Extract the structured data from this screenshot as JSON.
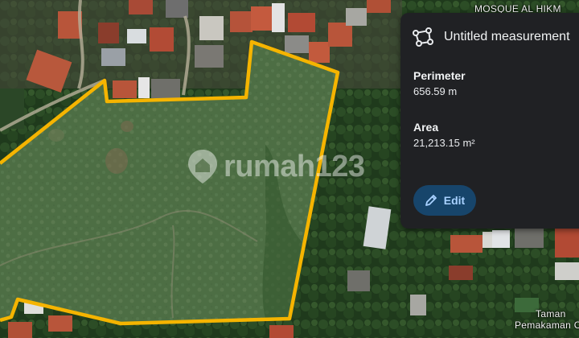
{
  "map": {
    "labels": {
      "mosque": "MOSQUE AL HIKM",
      "taman_line1": "Taman",
      "taman_line2": "Pemakaman Cu"
    },
    "watermark": "rumah123",
    "outline_color": "#f5b400"
  },
  "measurement_panel": {
    "title": "Untitled measurement",
    "icon": "polygon-measure-icon",
    "perimeter_label": "Perimeter",
    "perimeter_value": "656.59 m",
    "area_label": "Area",
    "area_value": "21,213.15 m²",
    "edit_label": "Edit",
    "edit_icon": "pencil-icon"
  }
}
